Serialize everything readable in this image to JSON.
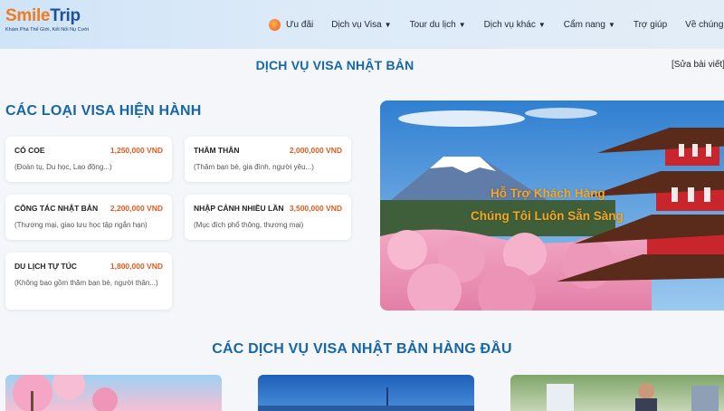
{
  "header": {
    "logo": {
      "brand_smile": "Smile",
      "brand_trip": "Trip",
      "tagline": "Khám Phá Thế Giới, Kết Nối Nụ Cười"
    },
    "nav": [
      {
        "label": "Ưu đãi",
        "icon": "promo-icon",
        "has_caret": false
      },
      {
        "label": "Dịch vụ Visa",
        "has_caret": true
      },
      {
        "label": "Tour du lịch",
        "has_caret": true
      },
      {
        "label": "Dịch vụ khác",
        "has_caret": true
      },
      {
        "label": "Cẩm nang",
        "has_caret": true
      },
      {
        "label": "Trợ giúp",
        "has_caret": false
      },
      {
        "label": "Về chúng tôi",
        "has_caret": false
      }
    ]
  },
  "page": {
    "title": "DỊCH VỤ VISA NHẬT BẢN",
    "edit_link": "[Sửa bài viết]"
  },
  "visa_section": {
    "heading": "CÁC LOẠI VISA HIỆN HÀNH",
    "cards": [
      {
        "name": "CÓ COE",
        "price": "1,250,000 VND",
        "desc": "(Đoàn tụ, Du học, Lao động...)"
      },
      {
        "name": "THĂM THÂN",
        "price": "2,000,000 VND",
        "desc": "(Thăm bạn bè, gia đình, người yêu...)"
      },
      {
        "name": "CÔNG TÁC NHẬT BẢN",
        "price": "2,200,000 VND",
        "desc": "(Thương mại, giao lưu học tập ngắn hạn)"
      },
      {
        "name": "NHẬP CẢNH NHIỀU LẦN",
        "price": "3,500,000 VND",
        "desc": "(Mục đích phổ thông, thương mại)"
      },
      {
        "name": "DU LỊCH TỰ TÚC",
        "price": "1,800,000 VND",
        "desc": "(Không bao gồm thăm bạn bè, người thân...)"
      }
    ]
  },
  "banner": {
    "line1": "Hỗ Trợ Khách Hàng",
    "line2": "Chúng Tôi Luôn Sẵn Sàng"
  },
  "top_services": {
    "heading": "CÁC DỊCH VỤ VISA NHẬT BẢN HÀNG ĐẦU"
  },
  "colors": {
    "accent_blue": "#1766a8",
    "price_orange": "#e05a1c",
    "logo_orange": "#f07a1e",
    "logo_blue": "#1e4f9a"
  }
}
